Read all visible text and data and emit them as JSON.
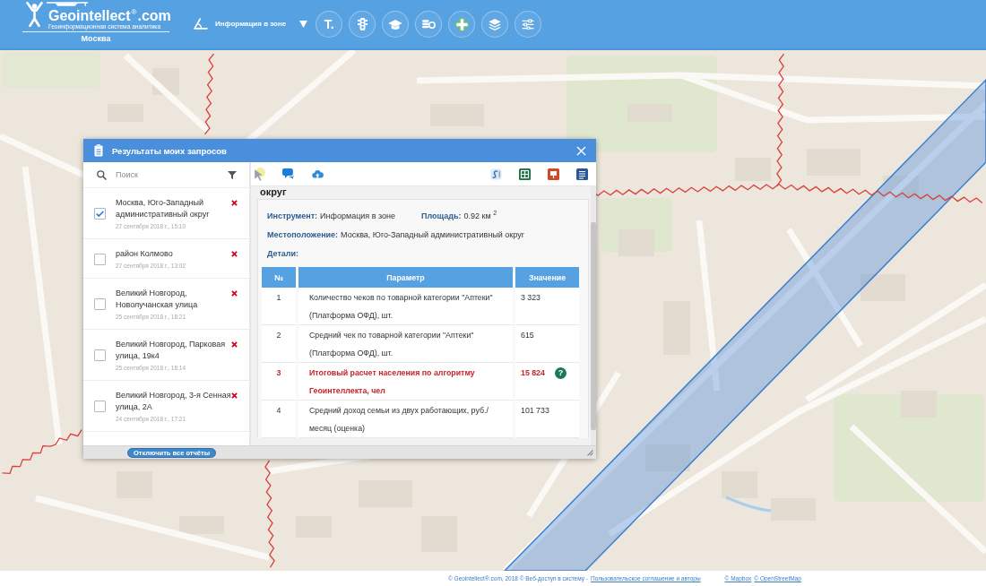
{
  "header": {
    "logo": {
      "title": "Geointellect$^{®}$.com",
      "subtitle": "Геоинформационная система аналитика",
      "city": "Москва"
    },
    "tool_selector": {
      "label": "Информация в зоне"
    },
    "tool_buttons": [
      {
        "kind": "text",
        "label": "T."
      },
      {
        "kind": "traffic-light"
      },
      {
        "kind": "graduation-cap"
      },
      {
        "kind": "coins"
      },
      {
        "kind": "medical-cross"
      },
      {
        "kind": "layers"
      },
      {
        "kind": "sliders"
      }
    ]
  },
  "dialog": {
    "title": "Результаты моих запросов",
    "search": {
      "placeholder": "Поиск"
    },
    "requests": [
      {
        "name": "Москва, Юго-Западный административный округ",
        "date": "27 сентября 2018 г., 15:10",
        "checked": true
      },
      {
        "name": "район Колмово",
        "date": "27 сентября 2018 г., 13:02",
        "checked": false
      },
      {
        "name": "Великий Новгород, Новолучанская улица",
        "date": "25 сентября 2018 г., 18:21",
        "checked": false
      },
      {
        "name": "Великий Новгород, Парковая улица, 19к4",
        "date": "25 сентября 2018 г., 18:14",
        "checked": false
      },
      {
        "name": "Великий Новгород, 3-я Сенная улица, 2А",
        "date": "24 сентября 2018 г., 17:21",
        "checked": false
      }
    ],
    "disable_all_button": "Отключить все отчёты",
    "toolbar": {
      "left": [
        {
          "kind": "cursor"
        },
        {
          "kind": "chat"
        },
        {
          "kind": "cloud"
        }
      ],
      "right": [
        {
          "kind": "wave"
        },
        {
          "kind": "spreadsheet"
        },
        {
          "kind": "presentation"
        },
        {
          "kind": "document"
        }
      ]
    },
    "report": {
      "title": "округ",
      "info_rows": [
        {
          "fields": [
            {
              "label": "Инструмент:",
              "value": "Информация в зоне"
            },
            {
              "label": "Площадь:",
              "value": "0.92 км $^{2}$"
            }
          ]
        },
        {
          "fields": [
            {
              "label": "Местоположение:",
              "value": "Москва, Юго-Западный административный округ"
            }
          ]
        },
        {
          "fields": [
            {
              "label": "Детали:"
            }
          ]
        }
      ],
      "table": {
        "columns": [
          "№",
          "Параметр",
          "Значение"
        ],
        "rows": [
          {
            "cells": [
              "1",
              "Количество чеков по товарной категории \"Аптеки\" (Платформа ОФД), шт.",
              "3 323"
            ],
            "highlighted": false
          },
          {
            "cells": [
              "2",
              "Средний чек по товарной категории \"Аптеки\" (Платформа ОФД), шт.",
              "615"
            ],
            "highlighted": false
          },
          {
            "cells": [
              "3",
              "Итоговый расчет населения по алгоритму Геоинтеллекта, чел",
              "15 824"
            ],
            "highlighted": true,
            "help": "?"
          },
          {
            "cells": [
              "4",
              "Средний доход семьи из двух работающих, руб./месяц (оценка)",
              "101 733"
            ],
            "highlighted": false
          }
        ]
      }
    }
  },
  "footer": {
    "copyright": "© Geointellect®.com, 2018 © Веб-доступ в систему -",
    "agreement_link": "Пользовательское соглашение и авторы",
    "attribution_links": [
      "© Mapbox",
      "© OpenStreetMap"
    ]
  }
}
